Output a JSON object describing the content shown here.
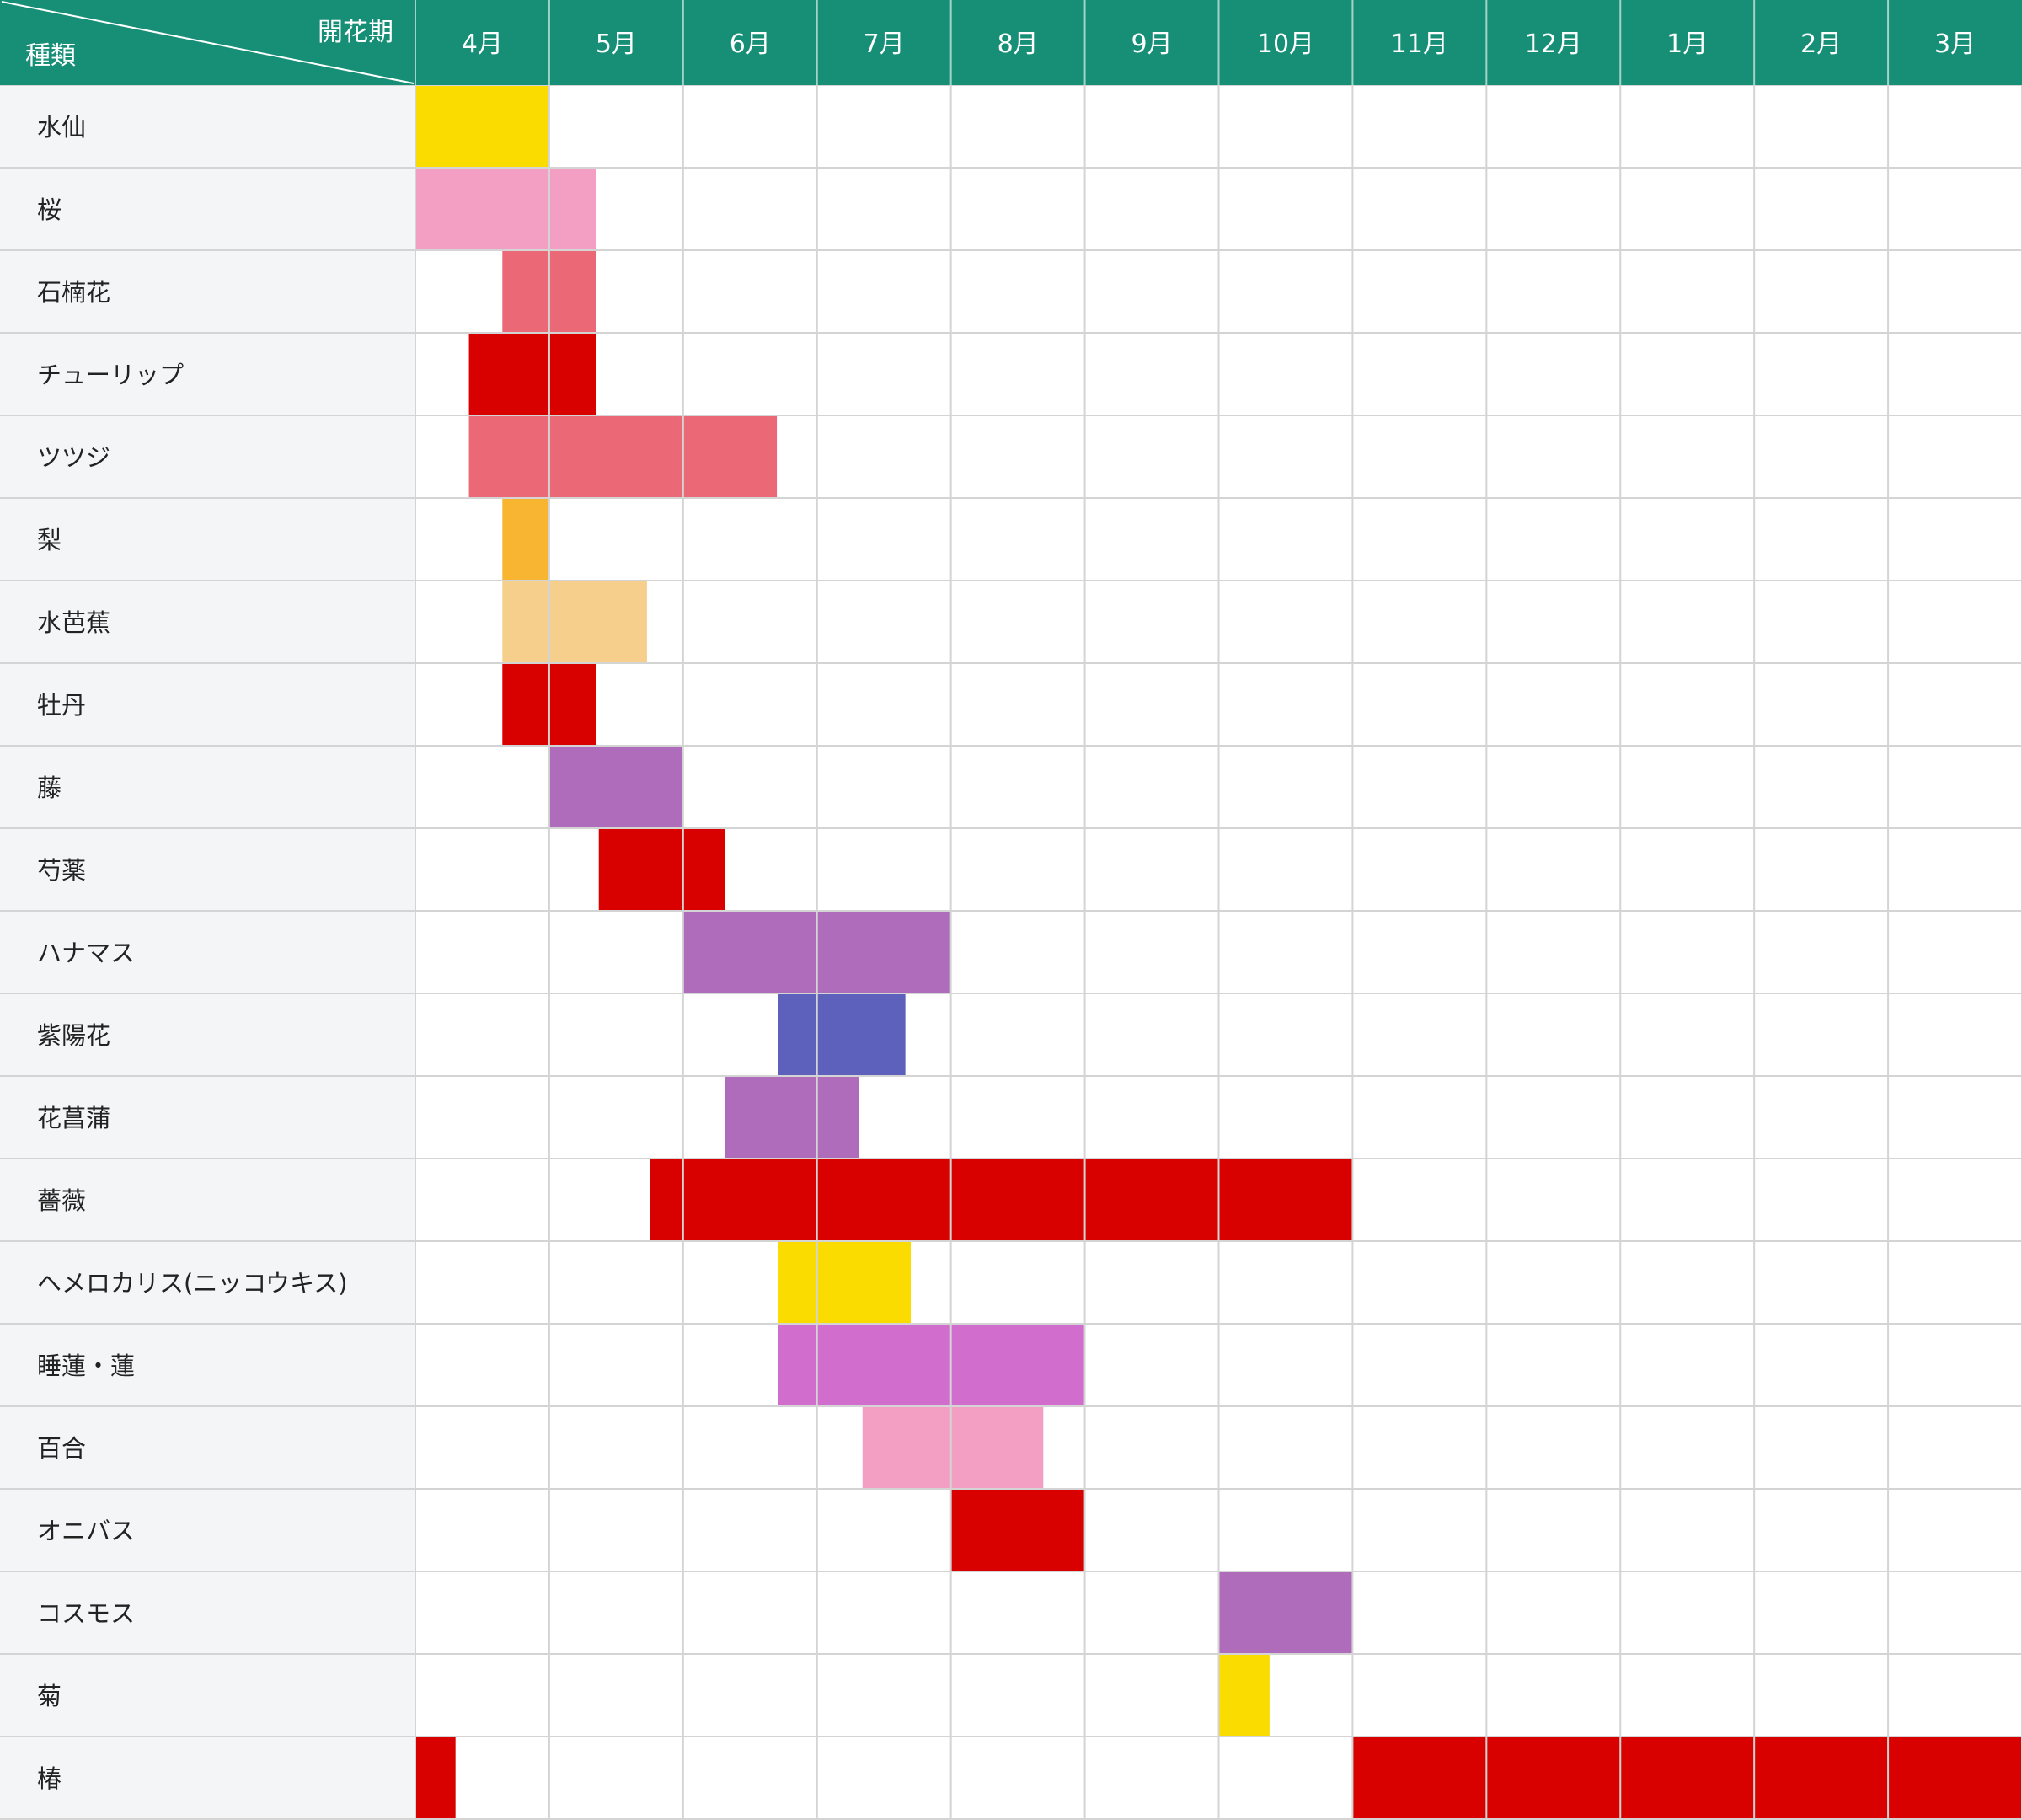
{
  "colors": {
    "header_bg": "#178f77",
    "label_bg": "#f4f5f7",
    "grid": "#d4d4d4",
    "yellow": "#fbdc00",
    "light_pink": "#f29fc3",
    "salmon": "#eb6977",
    "red": "#d90000",
    "orange": "#f8b531",
    "peach": "#f6cf8c",
    "purple": "#ae6cba",
    "indigo": "#5e61bb",
    "magenta": "#d06dcd"
  },
  "chart_data": {
    "type": "gantt",
    "header": {
      "row_label": "種類",
      "column_label": "開花期"
    },
    "months": [
      "4月",
      "5月",
      "6月",
      "7月",
      "8月",
      "9月",
      "10月",
      "11月",
      "12月",
      "1月",
      "2月",
      "3月"
    ],
    "rows": [
      {
        "name": "水仙",
        "color": "yellow",
        "periods": [
          [
            0.0,
            1.0
          ]
        ]
      },
      {
        "name": "桜",
        "color": "light_pink",
        "periods": [
          [
            0.0,
            1.35
          ]
        ]
      },
      {
        "name": "石楠花",
        "color": "salmon",
        "periods": [
          [
            0.65,
            1.35
          ]
        ]
      },
      {
        "name": "チューリップ",
        "color": "red",
        "periods": [
          [
            0.4,
            1.35
          ]
        ]
      },
      {
        "name": "ツツジ",
        "color": "salmon",
        "periods": [
          [
            0.4,
            2.7
          ]
        ]
      },
      {
        "name": "梨",
        "color": "orange",
        "periods": [
          [
            0.65,
            1.0
          ]
        ]
      },
      {
        "name": "水芭蕉",
        "color": "peach",
        "periods": [
          [
            0.65,
            1.73
          ]
        ]
      },
      {
        "name": "牡丹",
        "color": "red",
        "periods": [
          [
            0.65,
            1.35
          ]
        ]
      },
      {
        "name": "藤",
        "color": "purple",
        "periods": [
          [
            1.0,
            2.0
          ]
        ]
      },
      {
        "name": "芍薬",
        "color": "red",
        "periods": [
          [
            1.37,
            2.31
          ]
        ]
      },
      {
        "name": "ハナマス",
        "color": "purple",
        "periods": [
          [
            2.0,
            4.0
          ]
        ]
      },
      {
        "name": "紫陽花",
        "color": "indigo",
        "periods": [
          [
            2.71,
            3.66
          ]
        ]
      },
      {
        "name": "花菖蒲",
        "color": "purple",
        "periods": [
          [
            2.31,
            3.31
          ]
        ]
      },
      {
        "name": "薔薇",
        "color": "red",
        "periods": [
          [
            1.75,
            7.0
          ]
        ]
      },
      {
        "name": "ヘメロカリス(ニッコウキス)",
        "color": "yellow",
        "periods": [
          [
            2.71,
            3.7
          ]
        ]
      },
      {
        "name": "睡蓮・蓮",
        "color": "magenta",
        "periods": [
          [
            2.71,
            5.0
          ]
        ]
      },
      {
        "name": "百合",
        "color": "light_pink",
        "periods": [
          [
            3.34,
            4.69
          ]
        ]
      },
      {
        "name": "オニバス",
        "color": "red",
        "periods": [
          [
            4.0,
            5.0
          ]
        ]
      },
      {
        "name": "コスモス",
        "color": "purple",
        "periods": [
          [
            6.0,
            7.0
          ]
        ]
      },
      {
        "name": "菊",
        "color": "yellow",
        "periods": [
          [
            6.0,
            6.38
          ]
        ]
      },
      {
        "name": "椿",
        "color": "red",
        "periods": [
          [
            0.0,
            0.3
          ],
          [
            7.0,
            12.0
          ]
        ]
      }
    ]
  }
}
